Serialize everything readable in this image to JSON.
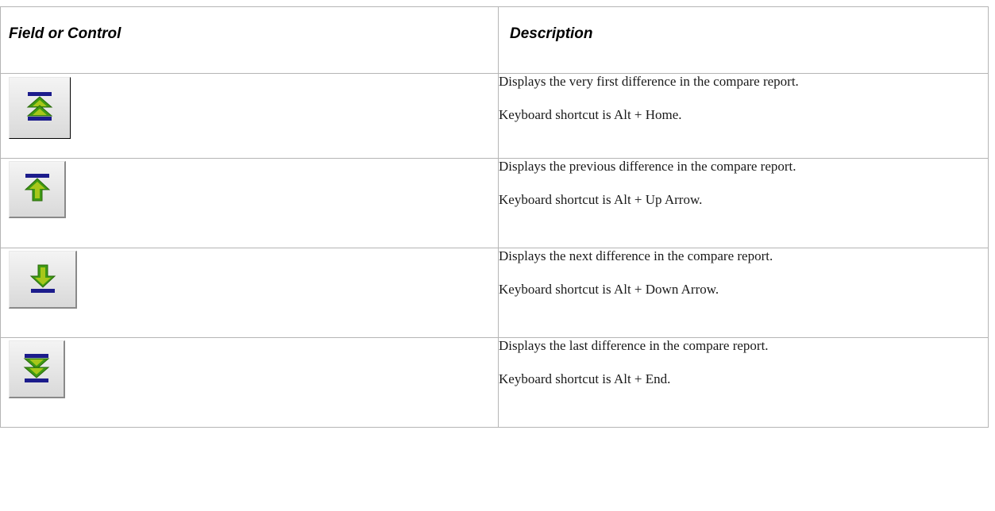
{
  "header": {
    "field_label": "Field or Control",
    "desc_label": "Description"
  },
  "rows": [
    {
      "icon": "first-difference-icon",
      "description": "Displays the very first difference in the compare report.",
      "shortcut": "Keyboard shortcut is Alt + Home."
    },
    {
      "icon": "previous-difference-icon",
      "description": "Displays the previous difference in the compare report.",
      "shortcut": "Keyboard shortcut is Alt + Up Arrow."
    },
    {
      "icon": "next-difference-icon",
      "description": "Displays the next difference in the compare report.",
      "shortcut": "Keyboard shortcut is Alt + Down Arrow."
    },
    {
      "icon": "last-difference-icon",
      "description": "Displays the last difference in the compare report.",
      "shortcut": "Keyboard shortcut is Alt + End."
    }
  ],
  "colors": {
    "bar": "#1c1c8c",
    "arrow": "#3f9a14",
    "arrow_light": "#a7c71a",
    "border": "#b5b5b5"
  }
}
